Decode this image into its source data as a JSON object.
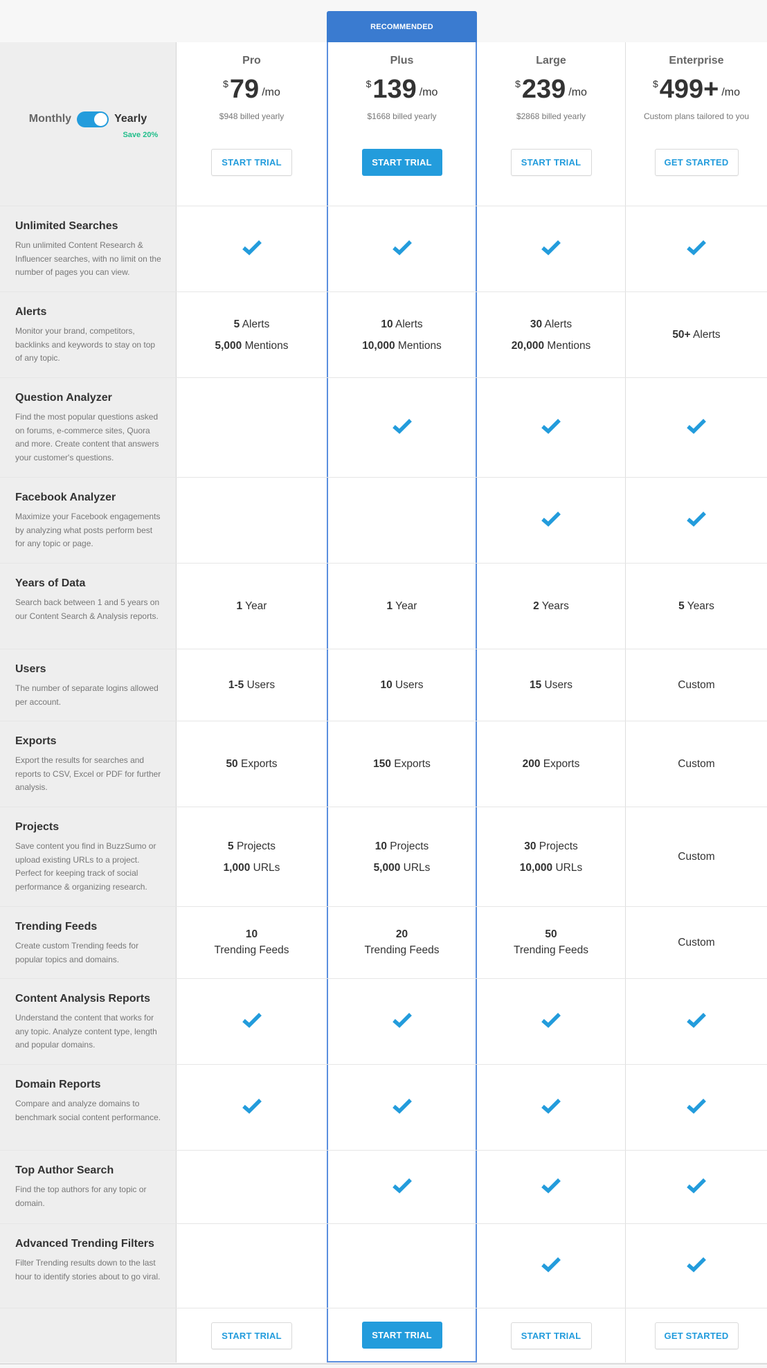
{
  "recommended_label": "RECOMMENDED",
  "billing_toggle": {
    "left_label": "Monthly",
    "right_label": "Yearly",
    "selected": "Yearly",
    "save_badge": "Save 20%"
  },
  "plans": [
    {
      "name": "Pro",
      "currency": "$",
      "amount": "79",
      "per": "/mo",
      "billed": "$948 billed yearly",
      "cta": "START TRIAL",
      "cta_style": "outline"
    },
    {
      "name": "Plus",
      "currency": "$",
      "amount": "139",
      "per": "/mo",
      "billed": "$1668 billed yearly",
      "cta": "START TRIAL",
      "cta_style": "filled",
      "recommended": true
    },
    {
      "name": "Large",
      "currency": "$",
      "amount": "239",
      "per": "/mo",
      "billed": "$2868 billed yearly",
      "cta": "START TRIAL",
      "cta_style": "outline"
    },
    {
      "name": "Enterprise",
      "currency": "$",
      "amount": "499+",
      "per": "/mo",
      "billed": "Custom plans tailored to you",
      "cta": "GET STARTED",
      "cta_style": "outline"
    }
  ],
  "features": [
    {
      "title": "Unlimited Searches",
      "desc": "Run unlimited Content Research & Influencer searches, with no limit on the number of pages you can view.",
      "values": [
        {
          "check": true
        },
        {
          "check": true
        },
        {
          "check": true
        },
        {
          "check": true
        }
      ]
    },
    {
      "title": "Alerts",
      "desc": "Monitor your brand, competitors, backlinks and keywords to stay on top of any topic.",
      "values": [
        {
          "lines": [
            {
              "b": "5",
              "t": " Alerts"
            },
            {
              "b": "5,000",
              "t": " Mentions"
            }
          ]
        },
        {
          "lines": [
            {
              "b": "10",
              "t": " Alerts"
            },
            {
              "b": "10,000",
              "t": " Mentions"
            }
          ]
        },
        {
          "lines": [
            {
              "b": "30",
              "t": " Alerts"
            },
            {
              "b": "20,000",
              "t": " Mentions"
            }
          ]
        },
        {
          "lines": [
            {
              "b": "50+",
              "t": " Alerts"
            }
          ]
        }
      ]
    },
    {
      "title": "Question Analyzer",
      "desc": "Find the most popular questions asked on forums, e-commerce sites, Quora and more. Create content that answers your customer's questions.",
      "values": [
        {
          "check": false
        },
        {
          "check": true
        },
        {
          "check": true
        },
        {
          "check": true
        }
      ]
    },
    {
      "title": "Facebook Analyzer",
      "desc": "Maximize your Facebook engagements by analyzing what posts perform best for any topic or page.",
      "values": [
        {
          "check": false
        },
        {
          "check": false
        },
        {
          "check": true
        },
        {
          "check": true
        }
      ]
    },
    {
      "title": "Years of Data",
      "desc": "Search back between 1 and 5 years on our Content Search & Analysis reports.",
      "values": [
        {
          "lines": [
            {
              "b": "1",
              "t": " Year"
            }
          ]
        },
        {
          "lines": [
            {
              "b": "1",
              "t": " Year"
            }
          ]
        },
        {
          "lines": [
            {
              "b": "2",
              "t": " Years"
            }
          ]
        },
        {
          "lines": [
            {
              "b": "5",
              "t": " Years"
            }
          ]
        }
      ]
    },
    {
      "title": "Users",
      "desc": "The number of separate logins allowed per account.",
      "values": [
        {
          "lines": [
            {
              "b": "1-5",
              "t": " Users"
            }
          ]
        },
        {
          "lines": [
            {
              "b": "10",
              "t": " Users"
            }
          ]
        },
        {
          "lines": [
            {
              "b": "15",
              "t": " Users"
            }
          ]
        },
        {
          "lines": [
            {
              "b": "",
              "t": "Custom"
            }
          ]
        }
      ]
    },
    {
      "title": "Exports",
      "desc": "Export the results for searches and reports to CSV, Excel or PDF for further analysis.",
      "values": [
        {
          "lines": [
            {
              "b": "50",
              "t": " Exports"
            }
          ]
        },
        {
          "lines": [
            {
              "b": "150",
              "t": " Exports"
            }
          ]
        },
        {
          "lines": [
            {
              "b": "200",
              "t": " Exports"
            }
          ]
        },
        {
          "lines": [
            {
              "b": "",
              "t": "Custom"
            }
          ]
        }
      ]
    },
    {
      "title": "Projects",
      "desc": "Save content you find in BuzzSumo or upload existing URLs to a project. Perfect for keeping track of social performance & organizing research.",
      "values": [
        {
          "lines": [
            {
              "b": "5",
              "t": " Projects"
            },
            {
              "b": "1,000",
              "t": " URLs"
            }
          ]
        },
        {
          "lines": [
            {
              "b": "10",
              "t": " Projects"
            },
            {
              "b": "5,000",
              "t": " URLs"
            }
          ]
        },
        {
          "lines": [
            {
              "b": "30",
              "t": " Projects"
            },
            {
              "b": "10,000",
              "t": " URLs"
            }
          ]
        },
        {
          "lines": [
            {
              "b": "",
              "t": "Custom"
            }
          ]
        }
      ]
    },
    {
      "title": "Trending Feeds",
      "desc": "Create custom Trending feeds for popular topics and domains.",
      "values": [
        {
          "stack": {
            "b": "10",
            "t": "Trending Feeds"
          }
        },
        {
          "stack": {
            "b": "20",
            "t": "Trending Feeds"
          }
        },
        {
          "stack": {
            "b": "50",
            "t": "Trending Feeds"
          }
        },
        {
          "lines": [
            {
              "b": "",
              "t": "Custom"
            }
          ]
        }
      ]
    },
    {
      "title": "Content Analysis Reports",
      "desc": "Understand the content that works for any topic. Analyze content type, length and popular domains.",
      "values": [
        {
          "check": true
        },
        {
          "check": true
        },
        {
          "check": true
        },
        {
          "check": true
        }
      ]
    },
    {
      "title": "Domain Reports",
      "desc": "Compare and analyze domains to benchmark social content performance.",
      "values": [
        {
          "check": true
        },
        {
          "check": true
        },
        {
          "check": true
        },
        {
          "check": true
        }
      ]
    },
    {
      "title": "Top Author Search",
      "desc": "Find the top authors for any topic or domain.",
      "values": [
        {
          "check": false
        },
        {
          "check": true
        },
        {
          "check": true
        },
        {
          "check": true
        }
      ]
    },
    {
      "title": "Advanced Trending Filters",
      "desc": "Filter Trending results down to the last hour to identify stories about to go viral.",
      "values": [
        {
          "check": false
        },
        {
          "check": false
        },
        {
          "check": true
        },
        {
          "check": true
        }
      ]
    }
  ],
  "colors": {
    "accent": "#239cdc",
    "recommended": "#3a7bd0",
    "save": "#1fbe8a",
    "label_bg": "#eeeeee"
  }
}
